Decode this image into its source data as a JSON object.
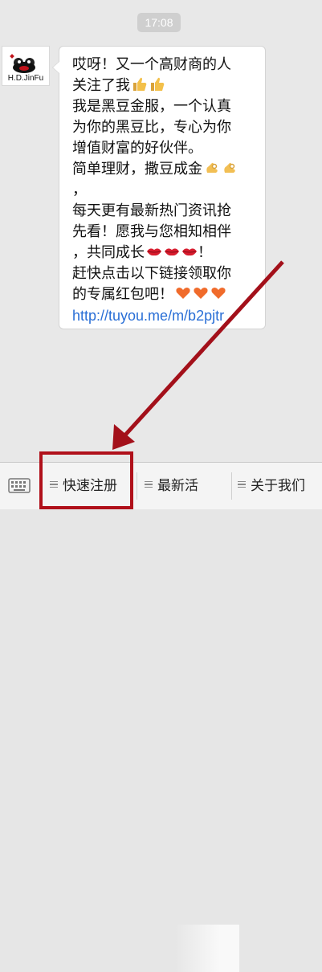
{
  "chat": {
    "time": "17:08",
    "avatar_name": "H.D.JinFu",
    "message": {
      "lines": [
        "哎呀！又一个高财商的人",
        "关注了我",
        "我是黑豆金服，一个认真",
        "为你的黑豆比，专心为你",
        "增值财富的好伙伴。",
        "简单理财，撒豆成金",
        "，",
        "每天更有最新热门资讯抢",
        "先看！愿我与您相知相伴",
        "，共同成长",
        "赶快点击以下链接领取你",
        "的专属红包吧！"
      ],
      "link": "http://tuyou.me/m/b2pjtr",
      "emoji": {
        "thumbs": "thumbs-up-icon",
        "ok_hands": "ok-hand-icon",
        "lips": "lips-icon",
        "hearts": "heart-icon",
        "exclaim": "！"
      }
    }
  },
  "menu": {
    "keyboard_icon": "keyboard-icon",
    "items": [
      "快速注册",
      "最新活",
      "关于我们"
    ]
  },
  "colors": {
    "highlight": "#b0101a",
    "link": "#2a6fd6"
  }
}
